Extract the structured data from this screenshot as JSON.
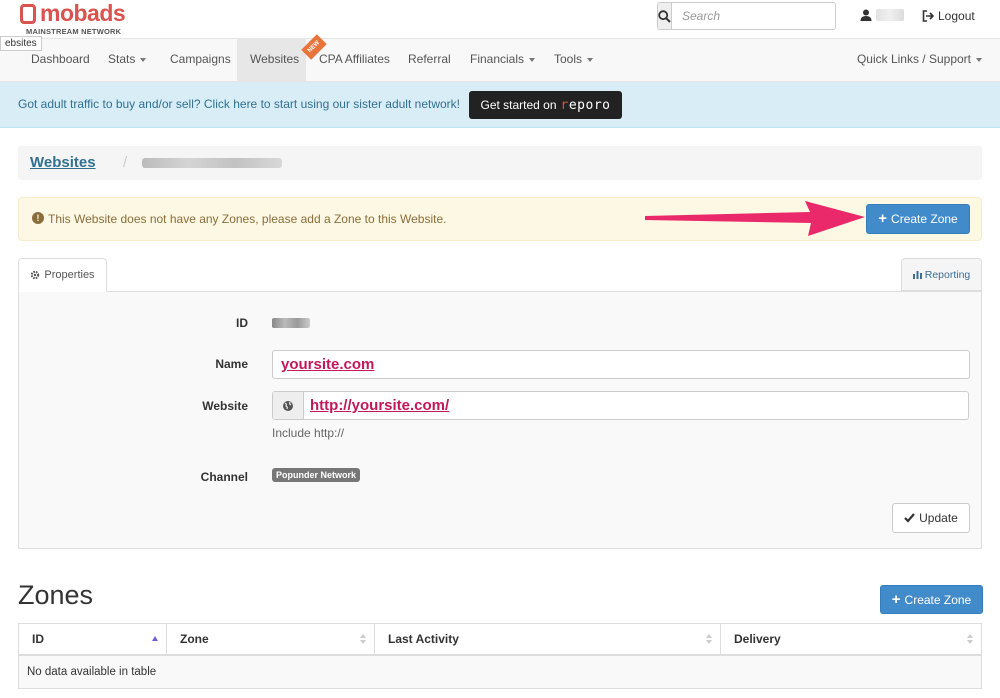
{
  "brand": {
    "name": "mobads",
    "tagline": "MAINSTREAM NETWORK",
    "color": "#d9534f"
  },
  "tooltip": "ebsites",
  "search": {
    "placeholder": "Search"
  },
  "user": {
    "logout_label": "Logout"
  },
  "nav": {
    "items": [
      {
        "label": "Dashboard",
        "dropdown": false,
        "active": false
      },
      {
        "label": "Stats",
        "dropdown": true,
        "active": false
      },
      {
        "label": "Campaigns",
        "dropdown": false,
        "active": false
      },
      {
        "label": "Websites",
        "dropdown": false,
        "active": true
      },
      {
        "label": "CPA Affiliates",
        "dropdown": false,
        "active": false,
        "badge": "NEW"
      },
      {
        "label": "Referral",
        "dropdown": false,
        "active": false
      },
      {
        "label": "Financials",
        "dropdown": true,
        "active": false
      },
      {
        "label": "Tools",
        "dropdown": true,
        "active": false
      }
    ],
    "right": {
      "label": "Quick Links / Support"
    }
  },
  "banner": {
    "text": "Got adult traffic to buy and/or sell? Click here to start using our sister adult network!",
    "button_prefix": "Get started on",
    "button_brand": "reporo"
  },
  "breadcrumb": {
    "root": "Websites",
    "separator": "/"
  },
  "alert": {
    "text": "This Website does not have any Zones, please add a Zone to this Website.",
    "button": "Create Zone"
  },
  "tabs": {
    "properties": "Properties",
    "reporting": "Reporting"
  },
  "form": {
    "id_label": "ID",
    "name_label": "Name",
    "name_value": "yoursite.com",
    "website_label": "Website",
    "website_value": "http://yoursite.com/",
    "website_help": "Include http://",
    "channel_label": "Channel",
    "channel_value": "Popunder Network",
    "update_button": "Update"
  },
  "zones": {
    "title": "Zones",
    "create_button": "Create Zone",
    "columns": [
      "ID",
      "Zone",
      "Last Activity",
      "Delivery"
    ],
    "empty_text": "No data available in table"
  },
  "colors": {
    "primary": "#428bca",
    "info_bg": "#d9edf7",
    "warning_bg": "#fcf8e3",
    "annotation": "#e91e63"
  }
}
